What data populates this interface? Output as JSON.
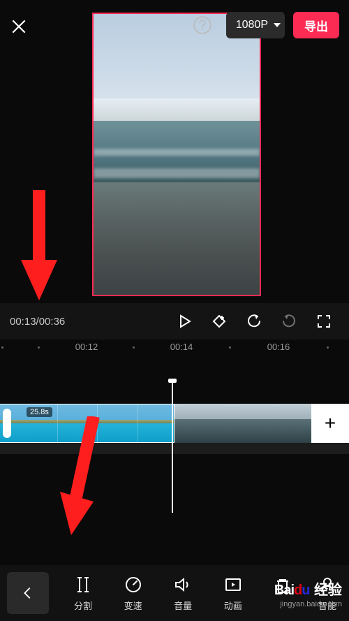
{
  "topbar": {
    "resolution": "1080P",
    "export_label": "导出"
  },
  "playback": {
    "current": "00:13",
    "total": "00:36"
  },
  "ruler": {
    "labels": [
      "00:12",
      "00:14",
      "00:16"
    ]
  },
  "timeline": {
    "clip_duration": "25.8s",
    "add_label": "+"
  },
  "toolbar": {
    "items": [
      {
        "label": "分割"
      },
      {
        "label": "变速"
      },
      {
        "label": "音量"
      },
      {
        "label": "动画"
      },
      {
        "label": "智能"
      }
    ]
  },
  "watermark": {
    "brand_a": "Bai",
    "brand_b": "d",
    "brand_c": "u",
    "cn": "经验",
    "url": "jingyan.baidu.com"
  }
}
